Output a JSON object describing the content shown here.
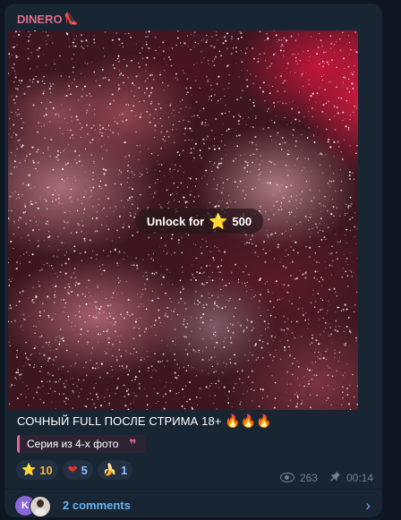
{
  "channel": {
    "name": "DINERO",
    "emoji": "👠"
  },
  "media": {
    "unlock_label": "Unlock for",
    "star_icon": "⭐",
    "price": "500"
  },
  "post": {
    "caption": "СОЧНЫЙ  FULL ПОСЛЕ СТРИМА 18+",
    "caption_emojis": "🔥🔥🔥",
    "quote_text": "Серия из 4-х фото",
    "quote_icon": "❞"
  },
  "reactions": [
    {
      "emoji": "⭐",
      "count": "10"
    },
    {
      "emoji": "❤",
      "count": "5"
    },
    {
      "emoji": "🍌",
      "count": "1"
    }
  ],
  "meta": {
    "views": "263",
    "time": "00:14"
  },
  "comments": {
    "avatar_letter": "K",
    "label": "2 comments",
    "chevron": "›"
  },
  "colors": {
    "background": "#0e1621",
    "bubble": "#182533",
    "accent": "#6ab2f2",
    "channel_name": "#e06c8a",
    "quote_border": "#e2669a",
    "star": "#f6c12b"
  }
}
